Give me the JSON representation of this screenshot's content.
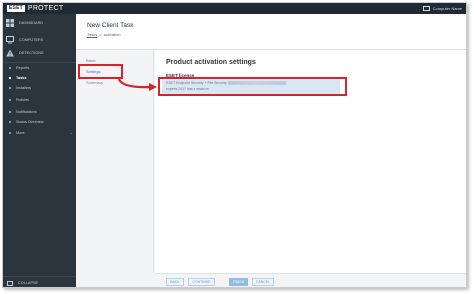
{
  "app": {
    "logo_mark": "ESET",
    "logo_text": "PROTECT",
    "user_label": "Computer Name"
  },
  "sidebar": {
    "items": [
      {
        "label": "DASHBOARD",
        "icon": "dashboard-icon"
      },
      {
        "label": "COMPUTERS",
        "icon": "computers-icon"
      },
      {
        "label": "DETECTIONS",
        "icon": "detections-icon"
      },
      {
        "label": "Reports"
      },
      {
        "label": "Tasks",
        "active": true
      },
      {
        "label": "Installers"
      },
      {
        "label": "Policies"
      },
      {
        "label": "Notifications"
      },
      {
        "label": "Status Overview"
      },
      {
        "label": "More"
      }
    ],
    "collapse_label": "COLLAPSE"
  },
  "header": {
    "title": "New Client Task",
    "breadcrumb": [
      {
        "label": "Tasks"
      },
      {
        "label": ">"
      },
      {
        "label": "activation"
      }
    ]
  },
  "wizard": {
    "steps": [
      {
        "label": "Basic",
        "active": false
      },
      {
        "label": "Settings",
        "active": true
      },
      {
        "label": "Summary",
        "active": false
      }
    ]
  },
  "main": {
    "title": "Product activation settings",
    "license_label": "ESET license",
    "license_line1": "ESET Endpoint Security + File Security",
    "license_line2": "expires 2017 has x seats/m"
  },
  "footer": {
    "back": "BACK",
    "continue": "CONTINUE",
    "finish": "FINISH",
    "cancel": "CANCEL"
  },
  "colors": {
    "sidebar_bg": "#2a353e",
    "topbar_bg": "#1f2a33",
    "accent": "#1d7fd3",
    "highlight": "#d8232a"
  }
}
